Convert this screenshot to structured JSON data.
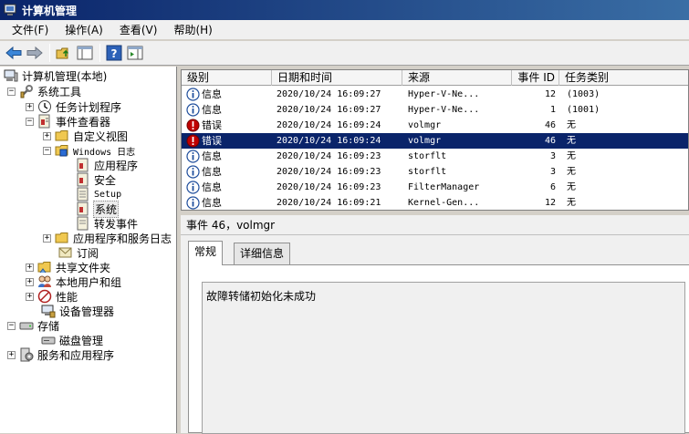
{
  "window": {
    "title": "计算机管理"
  },
  "menu": [
    "文件(F)",
    "操作(A)",
    "查看(V)",
    "帮助(H)"
  ],
  "toolbar": {
    "icons": [
      "back-arrow-icon",
      "forward-arrow-icon",
      "up-folder-icon",
      "show-hide-tree-icon",
      "help-icon",
      "action-pane-icon"
    ]
  },
  "tree": {
    "root": "计算机管理(本地)",
    "system_tools": "系统工具",
    "task_scheduler": "任务计划程序",
    "event_viewer": "事件查看器",
    "custom_views": "自定义视图",
    "windows_logs": "Windows 日志",
    "application": "应用程序",
    "security": "安全",
    "setup": "Setup",
    "system": "系统",
    "forwarded": "转发事件",
    "app_service_logs": "应用程序和服务日志",
    "subscriptions": "订阅",
    "shared_folders": "共享文件夹",
    "local_users": "本地用户和组",
    "performance": "性能",
    "device_manager": "设备管理器",
    "storage": "存储",
    "disk_management": "磁盘管理",
    "services_apps": "服务和应用程序"
  },
  "events": {
    "columns": [
      "级别",
      "日期和时间",
      "来源",
      "事件 ID",
      "任务类别"
    ],
    "rows": [
      {
        "level": "信息",
        "type": "info",
        "datetime": "2020/10/24 16:09:27",
        "source": "Hyper-V-Ne...",
        "id": "12",
        "category": "(1003)"
      },
      {
        "level": "信息",
        "type": "info",
        "datetime": "2020/10/24 16:09:27",
        "source": "Hyper-V-Ne...",
        "id": "1",
        "category": "(1001)"
      },
      {
        "level": "错误",
        "type": "error",
        "datetime": "2020/10/24 16:09:24",
        "source": "volmgr",
        "id": "46",
        "category": "无"
      },
      {
        "level": "错误",
        "type": "error",
        "datetime": "2020/10/24 16:09:24",
        "source": "volmgr",
        "id": "46",
        "category": "无",
        "selected": true
      },
      {
        "level": "信息",
        "type": "info",
        "datetime": "2020/10/24 16:09:23",
        "source": "storflt",
        "id": "3",
        "category": "无"
      },
      {
        "level": "信息",
        "type": "info",
        "datetime": "2020/10/24 16:09:23",
        "source": "storflt",
        "id": "3",
        "category": "无"
      },
      {
        "level": "信息",
        "type": "info",
        "datetime": "2020/10/24 16:09:23",
        "source": "FilterManager",
        "id": "6",
        "category": "无"
      },
      {
        "level": "信息",
        "type": "info",
        "datetime": "2020/10/24 16:09:21",
        "source": "Kernel-Gen...",
        "id": "12",
        "category": "无"
      }
    ]
  },
  "detail": {
    "title": "事件 46，volmgr",
    "tab_general": "常规",
    "tab_details": "详细信息",
    "description": "故障转储初始化未成功"
  },
  "colors": {
    "title_start": "#0a246a",
    "title_end": "#3a6ea5",
    "selection": "#0a246a",
    "error": "#c00000",
    "info": "#1f4e9c"
  }
}
